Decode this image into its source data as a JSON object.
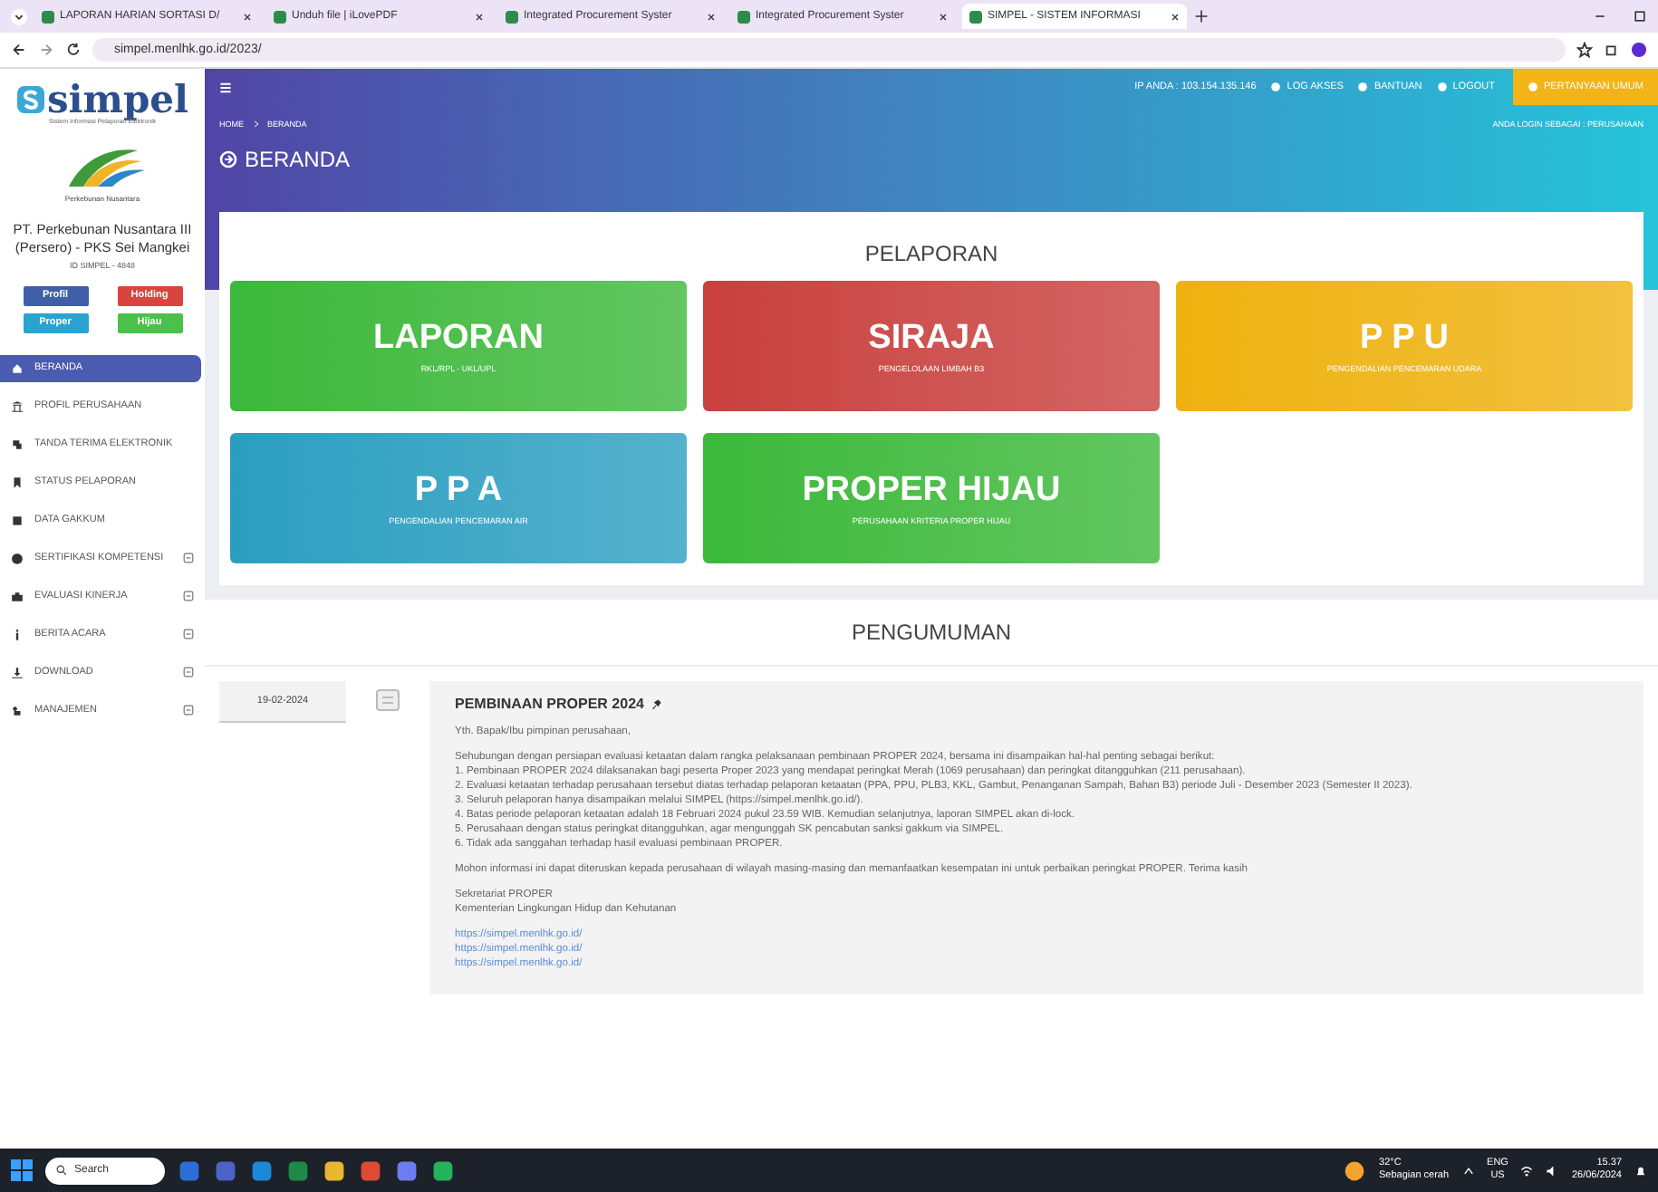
{
  "browser": {
    "tabs": [
      {
        "title": "LAPORAN HARIAN SORTASI D/",
        "selected": false
      },
      {
        "title": "Unduh file | iLovePDF",
        "selected": false
      },
      {
        "title": "Integrated Procurement Syster",
        "selected": false
      },
      {
        "title": "Integrated Procurement Syster",
        "selected": false
      },
      {
        "title": "SIMPEL - SISTEM INFORMASI",
        "selected": true
      }
    ],
    "url": "simpel.menlhk.go.id/2023/"
  },
  "sidebar": {
    "logo": "simpel",
    "logo_caption": "Sistem Informasi Pelaporan Elektronik",
    "company_logo_caption": "Perkebunan Nusantara",
    "company": "PT. Perkebunan Nusantara III (Persero) - PKS Sei Mangkei",
    "company_id": "ID SIMPEL - 4848",
    "buttons": [
      {
        "label": "Profil",
        "color": "#3f5fa8"
      },
      {
        "label": "Holding",
        "color": "#d9443f"
      },
      {
        "label": "Proper",
        "color": "#2aa3d0"
      },
      {
        "label": "Hijau",
        "color": "#4cc04a"
      }
    ],
    "menu": [
      {
        "label": "BERANDA",
        "selected": true,
        "has_submenu": false
      },
      {
        "label": "PROFIL PERUSAHAAN",
        "selected": false,
        "has_submenu": false
      },
      {
        "label": "TANDA TERIMA ELEKTRONIK",
        "selected": false,
        "has_submenu": false
      },
      {
        "label": "STATUS PELAPORAN",
        "selected": false,
        "has_submenu": false
      },
      {
        "label": "DATA GAKKUM",
        "selected": false,
        "has_submenu": false
      },
      {
        "label": "SERTIFIKASI KOMPETENSI",
        "selected": false,
        "has_submenu": true
      },
      {
        "label": "EVALUASI KINERJA",
        "selected": false,
        "has_submenu": true
      },
      {
        "label": "BERITA ACARA",
        "selected": false,
        "has_submenu": true
      },
      {
        "label": "DOWNLOAD",
        "selected": false,
        "has_submenu": true
      },
      {
        "label": "MANAJEMEN",
        "selected": false,
        "has_submenu": true
      }
    ]
  },
  "header": {
    "ip": "IP ANDA : 103.154.135.146",
    "links": [
      "LOG AKSES",
      "BANTUAN",
      "LOGOUT"
    ],
    "faq": "PERTANYAAN UMUM",
    "login_as": "ANDA LOGIN SEBAGAI : PERUSAHAAN",
    "breadcrumb": [
      "HOME",
      "BERANDA"
    ],
    "title": "BERANDA"
  },
  "pelaporan": {
    "title": "PELAPORAN",
    "cards": [
      {
        "title": "LAPORAN",
        "subtitle": "RKL/RPL - UKL/UPL",
        "color": "#3cb83a"
      },
      {
        "title": "SIRAJA",
        "subtitle": "PENGELOLAAN LIMBAH B3",
        "color": "#c8403d"
      },
      {
        "title": "P P U",
        "subtitle": "PENGENDALIAN PENCEMARAN UDARA",
        "color": "#eeb10e"
      },
      {
        "title": "P P A",
        "subtitle": "PENGENDALIAN PENCEMARAN AIR",
        "color": "#2b9ec0"
      },
      {
        "title": "PROPER HIJAU",
        "subtitle": "PERUSAHAAN KRITERIA PROPER HIJAU",
        "color": "#3cb83a"
      }
    ]
  },
  "pengumuman": {
    "title": "PENGUMUMAN",
    "items": [
      {
        "date": "19-02-2024",
        "title": "PEMBINAAN PROPER 2024",
        "paragraphs": [
          [
            "Yth. Bapak/Ibu pimpinan perusahaan,"
          ],
          [
            "Sehubungan dengan persiapan evaluasi ketaatan dalam rangka pelaksanaan pembinaan PROPER 2024, bersama ini disampaikan hal-hal penting sebagai berikut:",
            "1. Pembinaan PROPER 2024 dilaksanakan bagi peserta Proper 2023 yang mendapat peringkat Merah (1069 perusahaan) dan peringkat ditangguhkan (211 perusahaan).",
            "2. Evaluasi ketaatan terhadap perusahaan tersebut diatas terhadap pelaporan ketaatan (PPA, PPU, PLB3, KKL, Gambut, Penanganan Sampah, Bahan B3) periode Juli - Desember 2023 (Semester II 2023).",
            "3. Seluruh pelaporan hanya disampaikan melalui SIMPEL (https://simpel.menlhk.go.id/).",
            "4. Batas periode pelaporan ketaatan adalah 18 Februari 2024 pukul 23.59 WIB. Kemudian selanjutnya, laporan SIMPEL akan di-lock.",
            "5. Perusahaan dengan status peringkat ditangguhkan, agar mengunggah SK pencabutan sanksi gakkum via SIMPEL.",
            "6. Tidak ada sanggahan terhadap hasil evaluasi pembinaan PROPER."
          ],
          [
            "Mohon informasi ini dapat diteruskan kepada perusahaan di wilayah masing-masing dan memanfaatkan kesempatan ini untuk perbaikan peringkat PROPER. Terima kasih"
          ],
          [
            "Sekretariat PROPER",
            "Kementerian Lingkungan Hidup dan Kehutanan"
          ]
        ],
        "links": [
          "https://simpel.menlhk.go.id/",
          "https://simpel.menlhk.go.id/",
          "https://simpel.menlhk.go.id/"
        ]
      }
    ]
  },
  "taskbar": {
    "search": "Search",
    "weather_temp": "32°C",
    "weather_text": "Sebagian cerah",
    "lang": "ENG",
    "region": "US",
    "time": "15.37",
    "date": "26/06/2024"
  }
}
